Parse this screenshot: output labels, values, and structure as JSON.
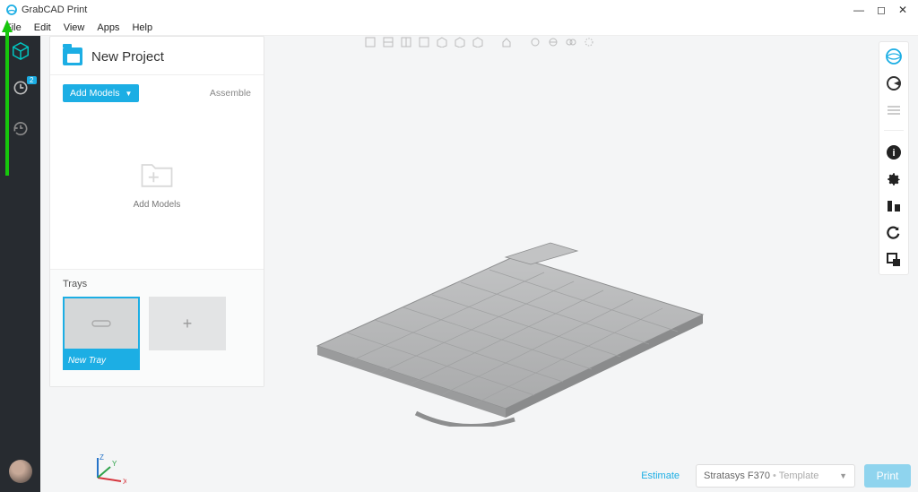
{
  "window": {
    "title": "GrabCAD Print"
  },
  "menu": {
    "file": "File",
    "edit": "Edit",
    "view": "View",
    "apps": "Apps",
    "help": "Help"
  },
  "leftrail": {
    "queue_badge": "2"
  },
  "panel": {
    "title": "New Project",
    "add_models": "Add Models",
    "assemble": "Assemble",
    "dropzone_text": "Add Models",
    "trays_title": "Trays",
    "new_tray": "New Tray"
  },
  "axis": {
    "x": "X",
    "y": "Y",
    "z": "Z"
  },
  "bottom": {
    "estimate": "Estimate",
    "printer": "Stratasys F370",
    "template": "Template",
    "print": "Print"
  }
}
